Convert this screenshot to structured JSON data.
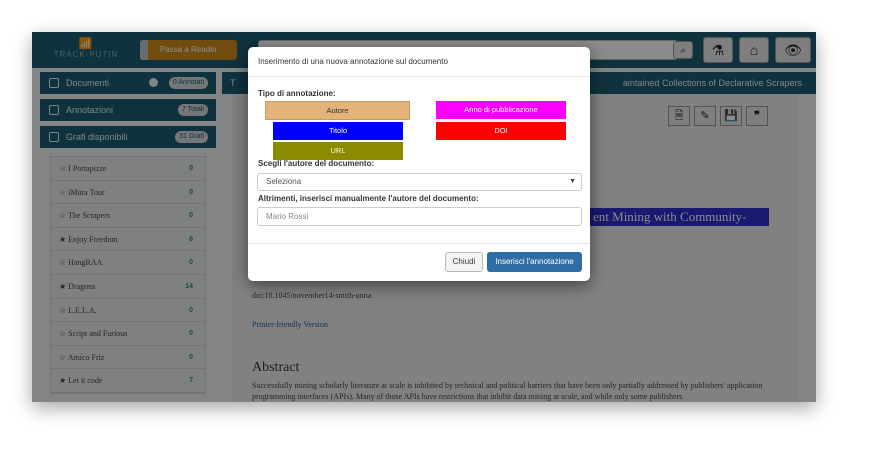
{
  "navbar": {
    "logo_text": "TRACK-PUTIN",
    "reader_button": "Passa a Reader",
    "search_value": "......"
  },
  "sidebar": {
    "documenti": {
      "label": "Documenti",
      "badge": "0 Annotati"
    },
    "annotazioni": {
      "label": "Annotazioni",
      "badge": "7 Totali"
    },
    "grafi": {
      "label": "Grafi disponibili",
      "badge": "31 Grafi"
    },
    "graphs": [
      {
        "star": "☆",
        "name": "I Portapizze",
        "count": "0"
      },
      {
        "star": "☆",
        "name": "iMura Tour",
        "count": "0"
      },
      {
        "star": "☆",
        "name": "The Scrapers",
        "count": "0"
      },
      {
        "star": "★",
        "name": "Enjoy Freedom",
        "count": "6"
      },
      {
        "star": "☆",
        "name": "HangRAA",
        "count": "0"
      },
      {
        "star": "★",
        "name": "Dragons",
        "count": "14"
      },
      {
        "star": "☆",
        "name": "L.E.L.A.",
        "count": "0"
      },
      {
        "star": "☆",
        "name": "Script and Furious",
        "count": "0"
      },
      {
        "star": "☆",
        "name": "Amico Friz",
        "count": "0"
      },
      {
        "star": "★",
        "name": "Let it code",
        "count": "7"
      }
    ]
  },
  "document": {
    "header_left": "T",
    "header_right": "aintained Collections of Declarative Scrapers",
    "title_fragment": "ent Mining with Community-",
    "doi": "doi:10.1045/november14-smith-unna",
    "printer_link": "Printer-friendly Version",
    "abstract_heading": "Abstract",
    "abstract_text": "Successfully mining scholarly literature at scale is inhibited by technical and political barriers that have been only partially addressed by publishers' application programming interfaces (APIs). Many of those APIs have restrictions that inhibit data mining at scale, and while only some publishers"
  },
  "modal": {
    "title": "Inserimento di una nuova annotazione sul documento",
    "type_label": "Tipo di annotazione:",
    "types": [
      {
        "label": "Autore",
        "color": "#e3b37a"
      },
      {
        "label": "Anno di pubblicazione",
        "color": "#ff00ff"
      },
      {
        "label": "Titolo",
        "color": "#0000ff"
      },
      {
        "label": "DOI",
        "color": "#ff0000"
      },
      {
        "label": "URL",
        "color": "#8b8b00"
      }
    ],
    "author_label": "Scegli l'autore del documento:",
    "select_value": "Seleziona",
    "manual_label": "Altrimenti, inserisci manualmente l'autore del documento:",
    "manual_placeholder": "Mario Rossi",
    "close_button": "Chiudi",
    "insert_button": "Inserisci l'annotazione"
  }
}
